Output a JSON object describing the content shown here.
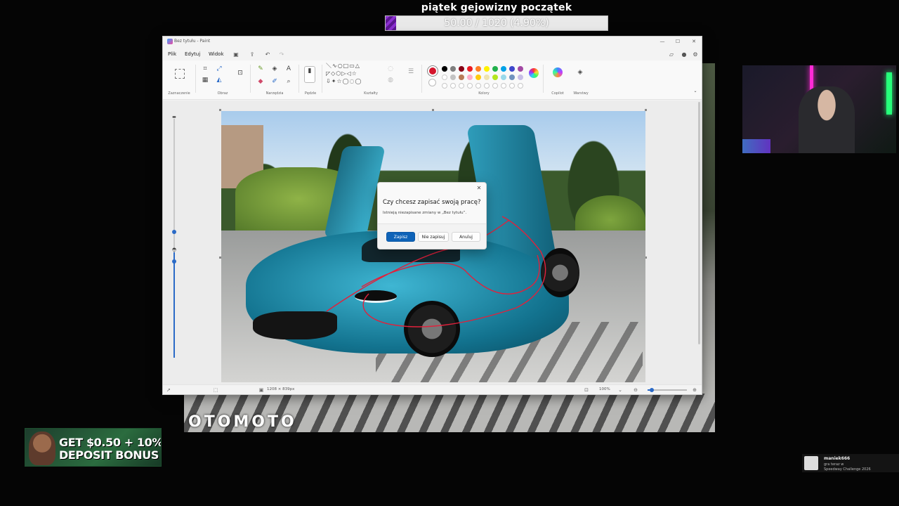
{
  "stream": {
    "goal_title": "piątek gejowizny początek",
    "goal_text": "50.00 / 1020 (4.90%)",
    "goal_progress_percent": 4.9
  },
  "background_photo": {
    "watermark": "OTOMOTO"
  },
  "ad": {
    "line1": "GET $0.50 + 10%",
    "line2": "DEPOSIT BONUS"
  },
  "chat_notification": {
    "user": "maniek666",
    "line1": "gra teraz w",
    "line2": "Speedway Challenge 2026"
  },
  "paint": {
    "window_title": "Bez tytułu - Paint",
    "window_controls": {
      "minimize": "—",
      "maximize": "☐",
      "close": "✕"
    },
    "menu": {
      "file": "Plik",
      "edit": "Edytuj",
      "view": "Widok"
    },
    "ribbon_groups": {
      "selection": "Zaznaczenie",
      "image": "Obraz",
      "tools": "Narzędzia",
      "brushes": "Pędzle",
      "shapes": "Kształty",
      "colors": "Kolory",
      "copilot": "Copilot",
      "layers": "Warstwy"
    },
    "palette": {
      "active": "#d4152c",
      "row1": [
        "#000000",
        "#7f7f7f",
        "#880015",
        "#ed1c24",
        "#ff7f27",
        "#fff200",
        "#22b14c",
        "#00a2e8",
        "#3f48cc",
        "#a349a4"
      ],
      "row2": [
        "#ffffff",
        "#c3c3c3",
        "#b97a57",
        "#ffaec9",
        "#ffc90e",
        "#efe4b0",
        "#b5e61d",
        "#99d9ea",
        "#7092be",
        "#c8bfe7"
      ]
    },
    "dialog": {
      "title": "Czy chcesz zapisać swoją pracę?",
      "message": "Istnieją niezapisane zmiany w „Bez tytułu”.",
      "save": "Zapisz",
      "dont_save": "Nie zapisuj",
      "cancel": "Anuluj",
      "close": "✕"
    },
    "status": {
      "dimensions": "1208 × 839px",
      "zoom": "100%"
    }
  }
}
